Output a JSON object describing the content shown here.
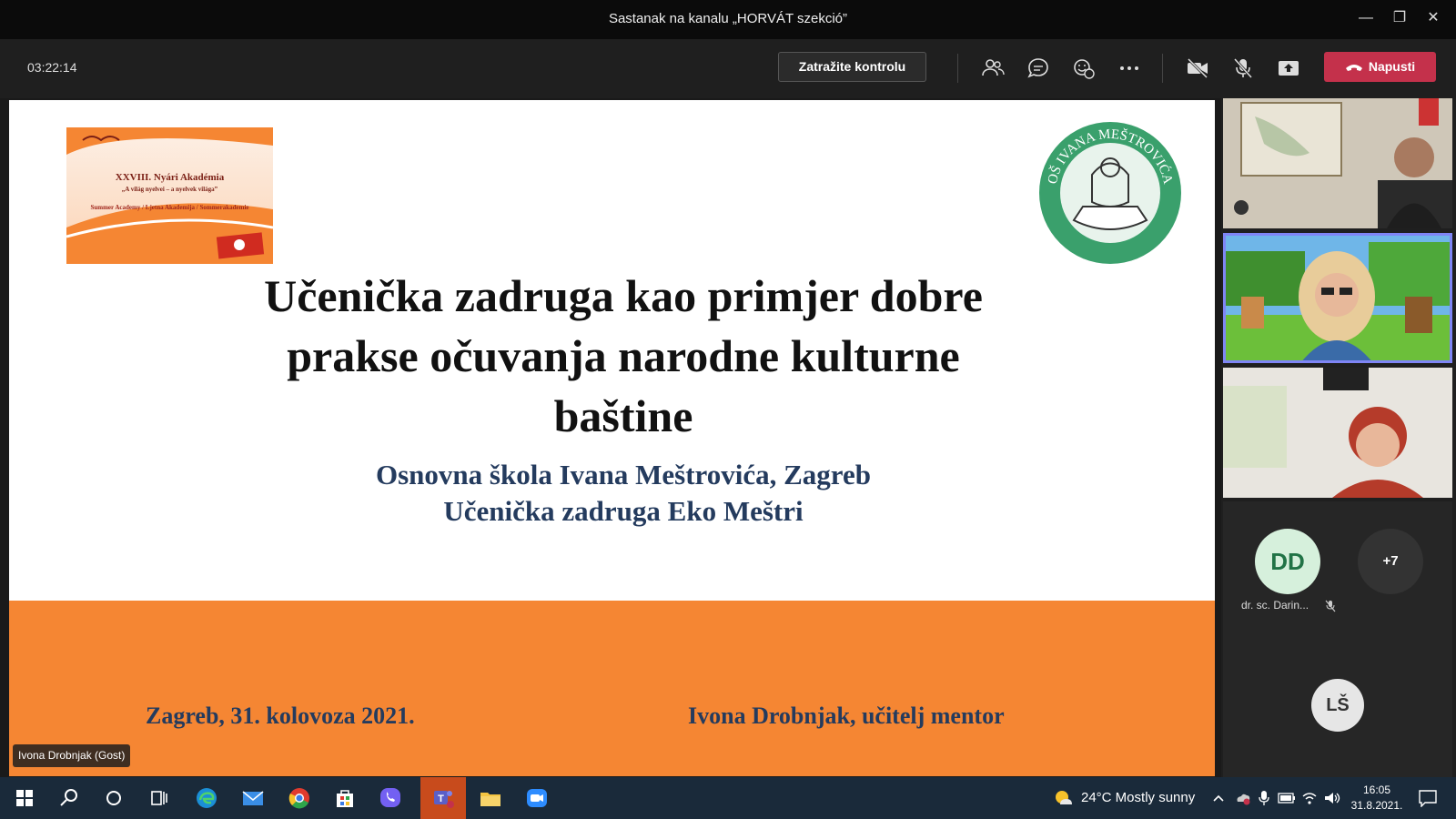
{
  "window": {
    "title": "Sastanak na kanalu „HORVÁT szekció”"
  },
  "toolbar": {
    "timer": "03:22:14",
    "request_control_label": "Zatražite kontrolu",
    "leave_label": "Napusti",
    "leave_color": "#c4314b"
  },
  "slide": {
    "academy_logo": {
      "line1": "XXVIII. Nyári Akadémia",
      "line2": "„A világ nyelvei – a nyelvek világa”",
      "line3": "Summer Academy / Ljetna Akademija / Sommerakademie"
    },
    "school_logo_text": "OŠ IVANA MEŠTROVIĆA",
    "title_line1": "Učenička zadruga kao primjer dobre",
    "title_line2": "prakse očuvanja narodne kulturne",
    "title_line3": "baštine",
    "subtitle_line1": "Osnovna škola Ivana Meštrovića, Zagreb",
    "subtitle_line2": "Učenička zadruga Eko Meštri",
    "footer_left": "Zagreb, 31. kolovoza 2021.",
    "footer_right": "Ivona Drobnjak, učitelj mentor",
    "band_color": "#f58633"
  },
  "speaker_tag": "Ivona Drobnjak (Gost)",
  "participants": {
    "avatar_dd": {
      "initials": "DD",
      "name": "dr. sc. Darin..."
    },
    "overflow": "+7",
    "avatar_ls": {
      "initials": "LŠ"
    }
  },
  "taskbar": {
    "weather": "24°C  Mostly sunny",
    "time": "16:05",
    "date": "31.8.2021."
  }
}
